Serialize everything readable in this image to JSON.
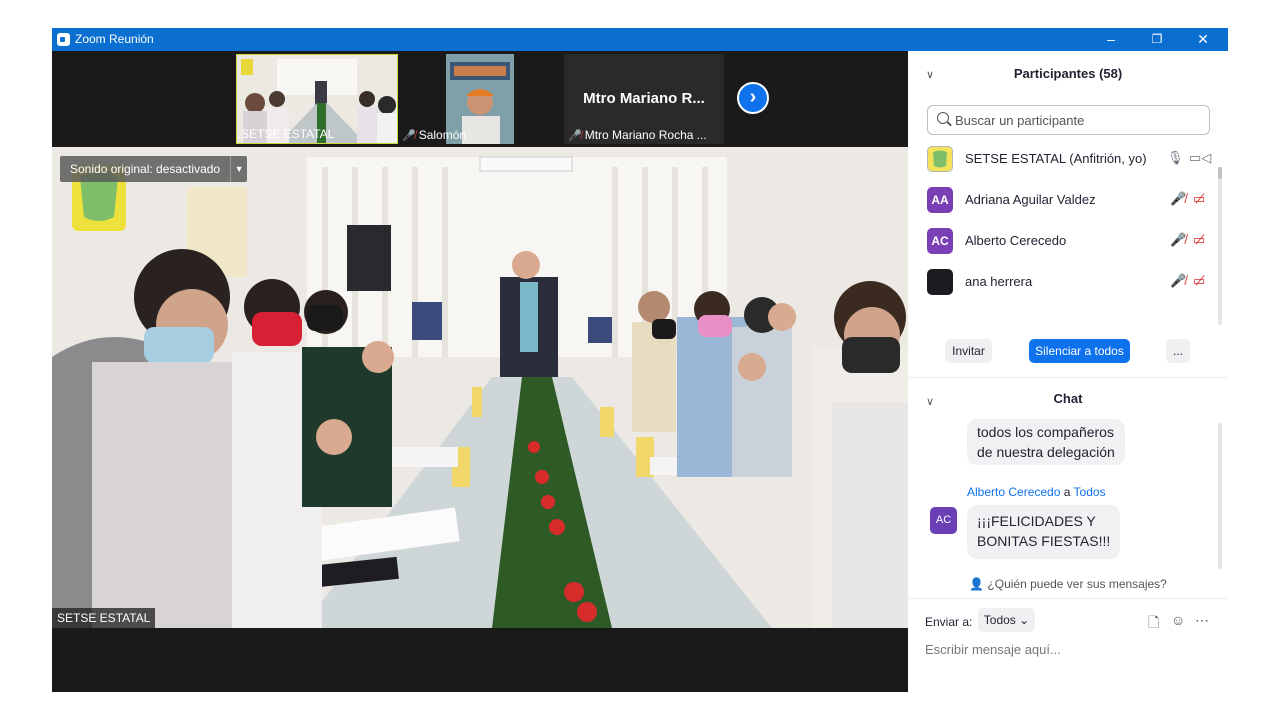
{
  "window": {
    "title": "Zoom Reunión",
    "controls": {
      "minimize": "–",
      "restore": "❐",
      "close": "✕"
    }
  },
  "thumbnails": [
    {
      "label": "SETSE ESTATAL",
      "muted": false
    },
    {
      "label": "Salomón",
      "muted": true
    },
    {
      "label": "Mtro Mariano Rocha ...",
      "big_name": "Mtro  Mariano  R...",
      "muted": true
    }
  ],
  "next_page_glyph": "›",
  "main_video": {
    "label": "SETSE ESTATAL",
    "original_sound": "Sonido original: desactivado"
  },
  "participants": {
    "header": "Participantes (58)",
    "search_placeholder": "Buscar un participante",
    "list": [
      {
        "name": "SETSE ESTATAL (Anfitrión, yo)",
        "initials": "",
        "color": "#f2e35a"
      },
      {
        "name": "Adriana Aguilar Valdez",
        "initials": "AA",
        "color": "#7b3fb5"
      },
      {
        "name": "Alberto Cerecedo",
        "initials": "AC",
        "color": "#7b3fb5"
      },
      {
        "name": "ana herrera",
        "initials": "",
        "color": "#1e1a22"
      }
    ],
    "buttons": {
      "invite": "Invitar",
      "mute_all": "Silenciar a todos",
      "more": "..."
    }
  },
  "chat": {
    "header": "Chat",
    "messages": [
      {
        "text_lines": [
          "todos los compañeros",
          "de nuestra delegación"
        ]
      },
      {
        "sender": "Alberto Cerecedo",
        "to_word": "a",
        "recipient": "Todos",
        "initials": "AC",
        "text_lines": [
          "¡¡¡FELICIDADES Y",
          "BONITAS FIESTAS!!!"
        ]
      }
    ],
    "who_can_see": "¿Quién puede ver sus mensajes?",
    "send_to_label": "Enviar a:",
    "send_to_value": "Todos",
    "input_placeholder": "Escribir mensaje aquí..."
  },
  "colors": {
    "titlebar": "#0b6fd1",
    "accent": "#0e72ed",
    "muted_red": "#e02828",
    "active_speaker": "#c8d63a"
  }
}
